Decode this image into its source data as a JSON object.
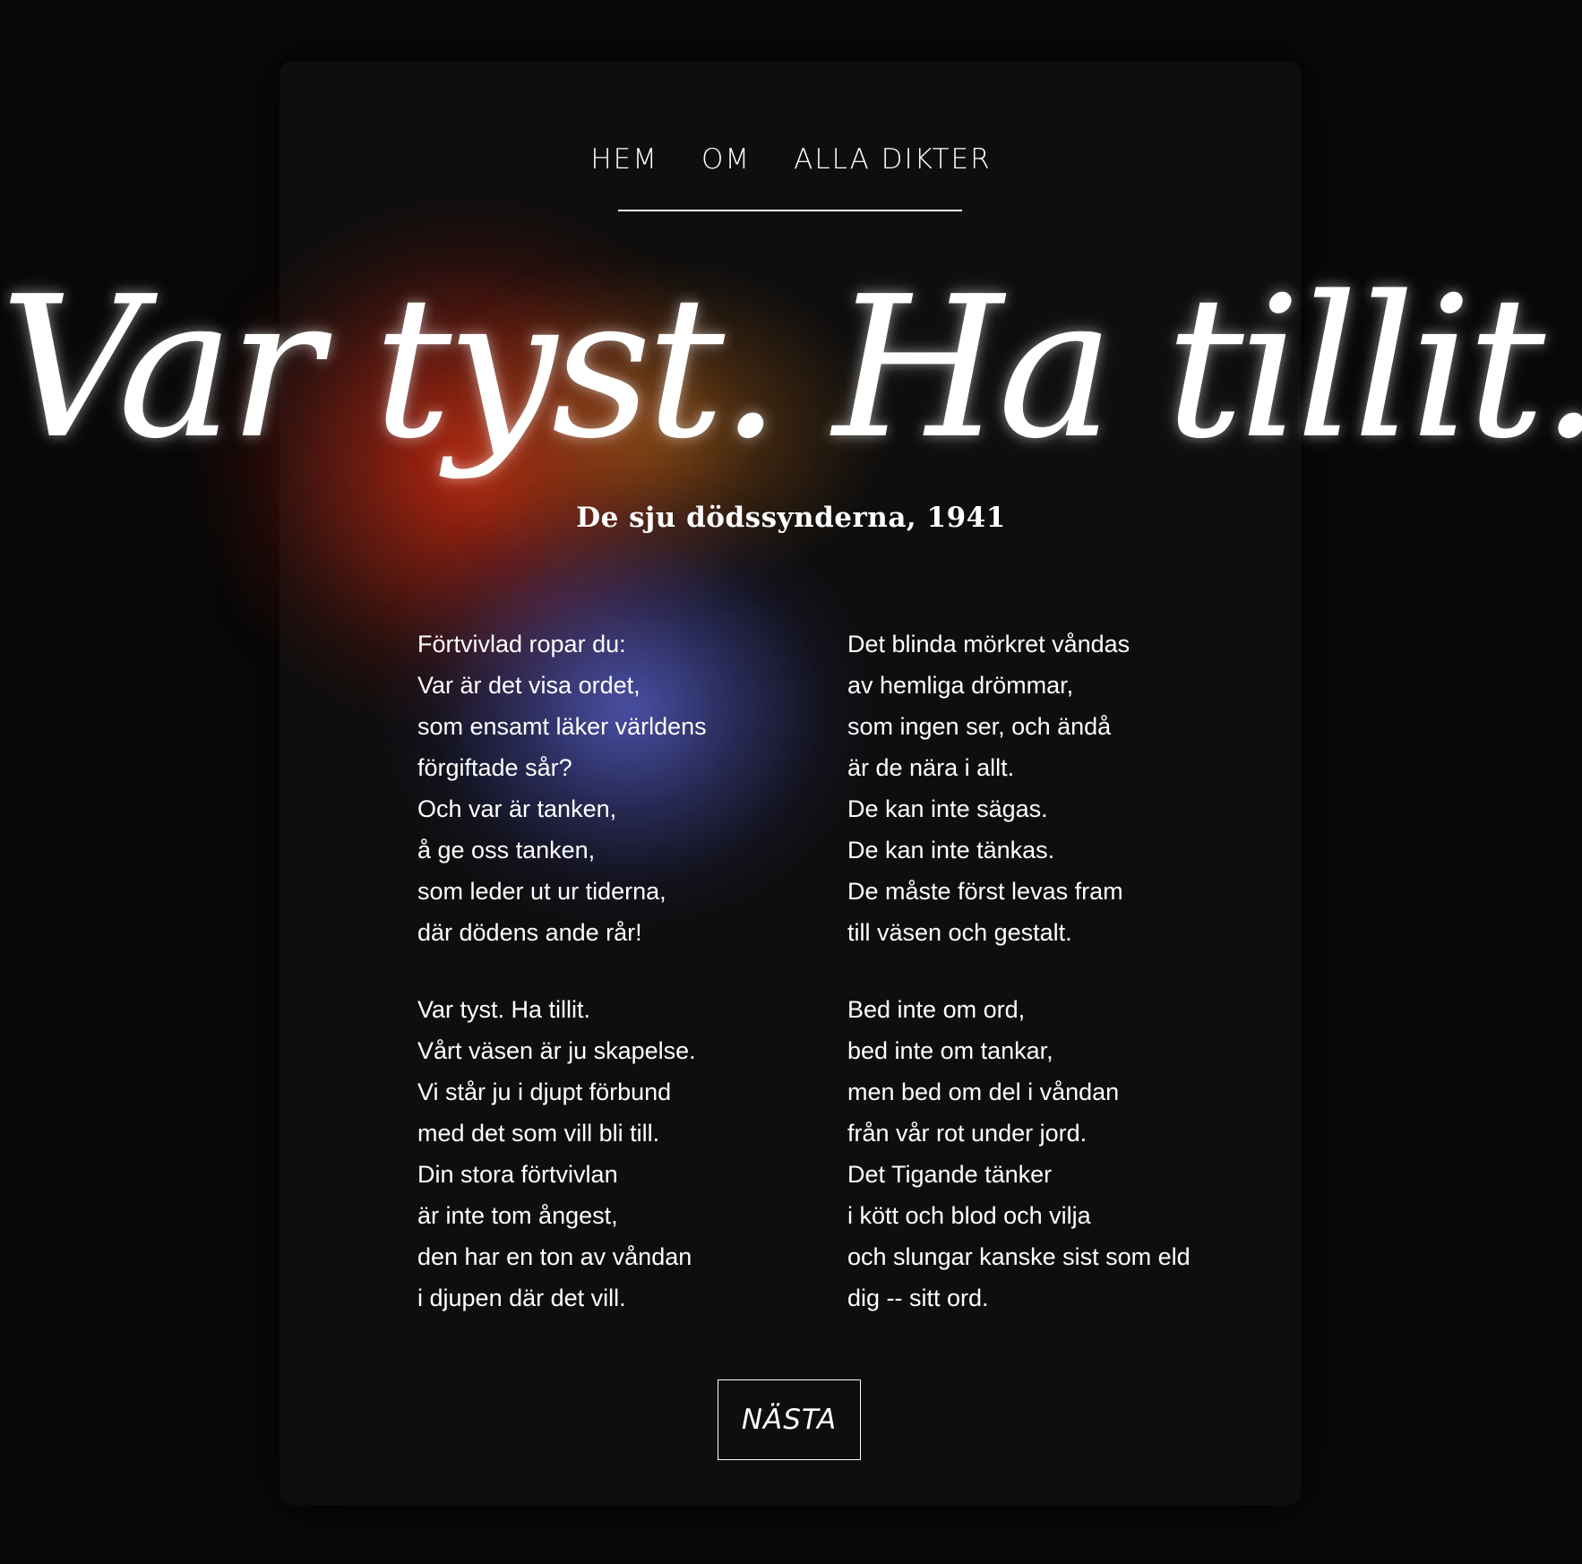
{
  "nav": {
    "items": [
      {
        "label": "HEM"
      },
      {
        "label": "OM"
      },
      {
        "label": "ALLA DIKTER"
      }
    ]
  },
  "poem": {
    "title": "Var tyst. Ha tillit.",
    "source": "De sju dödssynderna, 1941",
    "stanzas": [
      {
        "lines": [
          "Förtvivlad ropar du:",
          "Var är det visa ordet,",
          "som ensamt läker världens",
          "förgiftade sår?",
          "Och var är tanken,",
          "å ge oss tanken,",
          "som leder ut ur tiderna,",
          "där dödens ande rår!"
        ]
      },
      {
        "lines": [
          "Det blinda mörkret våndas",
          "av hemliga drömmar,",
          "som ingen ser, och ändå",
          "är de nära i allt.",
          "De kan inte sägas.",
          "De kan inte tänkas.",
          "De måste först levas fram",
          "till väsen och gestalt."
        ]
      },
      {
        "lines": [
          "Var tyst. Ha tillit.",
          "Vårt väsen är ju skapelse.",
          "Vi står ju i djupt förbund",
          "med det som vill bli till.",
          "Din stora förtvivlan",
          "är inte tom ångest,",
          "den har en ton av våndan",
          "i djupen där det vill."
        ]
      },
      {
        "lines": [
          "Bed inte om ord,",
          "bed inte om tankar,",
          "men bed om del i våndan",
          "från vår rot under jord.",
          "Det Tigande tänker",
          "i kött och blod och vilja",
          "och slungar kanske sist som eld",
          "dig -- sitt ord."
        ]
      }
    ]
  },
  "footer": {
    "next_label": "NÄSTA"
  },
  "colors": {
    "background": "#080808",
    "card": "#0e0e0e",
    "text": "#ffffff",
    "glow_red": "#cd2a12",
    "glow_orange": "#c3731e",
    "glow_blue": "#5c64d2"
  }
}
